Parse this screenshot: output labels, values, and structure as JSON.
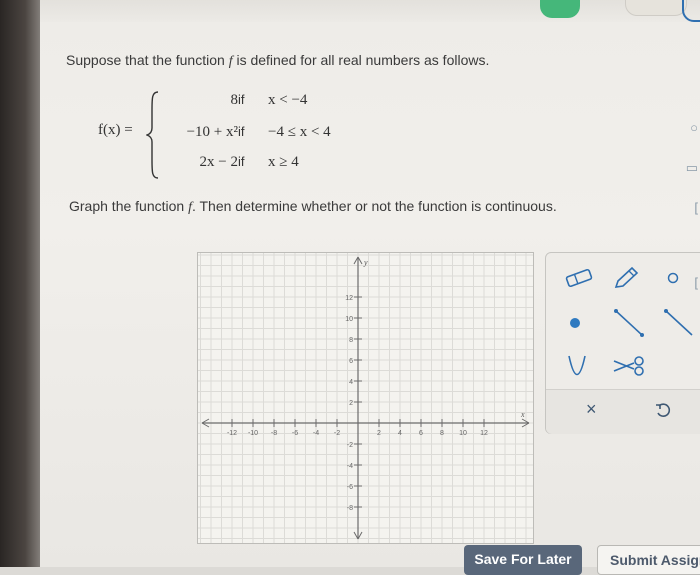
{
  "problem": {
    "intro_prefix": "Suppose that the function ",
    "function_name": "f",
    "intro_suffix": " is defined for all real numbers as follows.",
    "lhs": "f(x) =",
    "cases": [
      {
        "expr": "8",
        "if": "if",
        "cond": "x < −4"
      },
      {
        "expr": "−10 + x²",
        "if": "if",
        "cond": "−4 ≤ x < 4"
      },
      {
        "expr": "2x − 2",
        "if": "if",
        "cond": "x ≥ 4"
      }
    ],
    "instruction_prefix": "Graph the function ",
    "instruction_suffix": ". Then determine whether or not the function is continuous."
  },
  "graph": {
    "x_axis_label": "x",
    "y_axis_label": "y",
    "x_ticks": [
      "-12",
      "-10",
      "-8",
      "-6",
      "-4",
      "-2",
      "2",
      "4",
      "6",
      "8",
      "10",
      "12"
    ],
    "y_ticks": [
      "12",
      "10",
      "8",
      "6",
      "4",
      "2",
      "-2",
      "-4",
      "-6",
      "-8"
    ]
  },
  "tools": {
    "eraser_icon": "eraser-icon",
    "pencil_icon": "pencil-icon",
    "open_circle_icon": "open-circle-icon",
    "point_icon": "closed-point-icon",
    "line_segment_icon": "line-segment-icon",
    "ray_icon": "ray-icon",
    "parabola_icon": "parabola-icon",
    "scissors_icon": "scissors-icon",
    "clear_icon": "x-icon",
    "undo_icon": "undo-icon",
    "clear_label": "×"
  },
  "buttons": {
    "save_label": "Save For Later",
    "submit_label": "Submit Assignr"
  },
  "colors": {
    "save_button_bg": "#59677a",
    "accent_blue": "#2f7ac0",
    "top_icon_green": "#45b77a"
  }
}
